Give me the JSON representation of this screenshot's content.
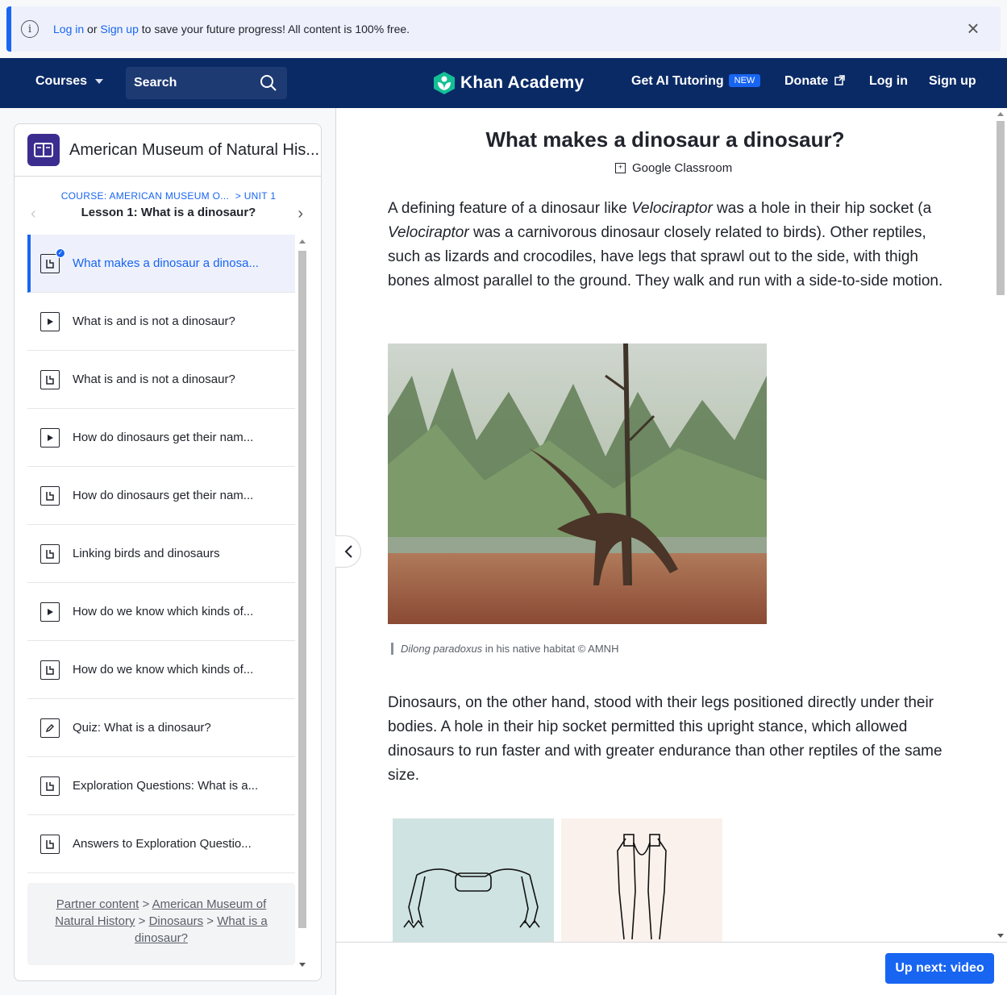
{
  "banner": {
    "login": "Log in",
    "or": "or",
    "signup": "Sign up",
    "rest": "to save your future progress! All content is 100% free."
  },
  "nav": {
    "courses": "Courses",
    "search_placeholder": "Search",
    "brand": "Khan Academy",
    "ai_tutoring": "Get AI Tutoring",
    "new_badge": "NEW",
    "donate": "Donate",
    "login": "Log in",
    "signup": "Sign up"
  },
  "sidebar": {
    "title": "American Museum of Natural His...",
    "course_crumb": "COURSE: AMERICAN MUSEUM O...",
    "unit_crumb": "> UNIT 1",
    "lesson": "Lesson 1: What is a dinosaur?",
    "items": [
      {
        "label": "What makes a dinosaur a dinosa...",
        "icon": "article-icon",
        "active": true
      },
      {
        "label": "What is and is not a dinosaur?",
        "icon": "video-icon"
      },
      {
        "label": "What is and is not a dinosaur?",
        "icon": "article-icon"
      },
      {
        "label": "How do dinosaurs get their nam...",
        "icon": "video-icon"
      },
      {
        "label": "How do dinosaurs get their nam...",
        "icon": "article-icon"
      },
      {
        "label": "Linking birds and dinosaurs",
        "icon": "article-icon"
      },
      {
        "label": "How do we know which kinds of...",
        "icon": "video-icon"
      },
      {
        "label": "How do we know which kinds of...",
        "icon": "article-icon"
      },
      {
        "label": "Quiz: What is a dinosaur?",
        "icon": "quiz-icon"
      },
      {
        "label": "Exploration Questions: What is a...",
        "icon": "article-icon"
      },
      {
        "label": "Answers to Exploration Questio...",
        "icon": "article-icon"
      }
    ],
    "footer": {
      "partner": "Partner content",
      "museum": "American Museum of Natural History",
      "dinosaurs": "Dinosaurs",
      "topic": "What is a dinosaur?",
      "sep": ">"
    }
  },
  "main": {
    "title": "What makes a dinosaur a dinosaur?",
    "google_classroom": "Google Classroom",
    "para1_a": "A defining feature of a dinosaur like ",
    "para1_b": "Velociraptor",
    "para1_c": " was a hole in their hip socket (a ",
    "para1_d": "Velociraptor",
    "para1_e": " was a carnivorous dinosaur closely related to birds). Other reptiles, such as lizards and crocodiles, have legs that sprawl out to the side, with thigh bones almost parallel to the ground. They walk and run with a side-to-side motion.",
    "caption_italic": "Dilong paradoxus",
    "caption_rest": " in his native habitat © AMNH",
    "para2": "Dinosaurs, on the other hand, stood with their legs positioned directly under their bodies. A hole in their hip socket permitted this upright stance, which allowed dinosaurs to run faster and with greater endurance than other reptiles of the same size.",
    "up_next": "Up next: video"
  },
  "colors": {
    "accent": "#1865f2",
    "nav_bg": "#0a2a66",
    "brand_green": "#14bf96"
  }
}
